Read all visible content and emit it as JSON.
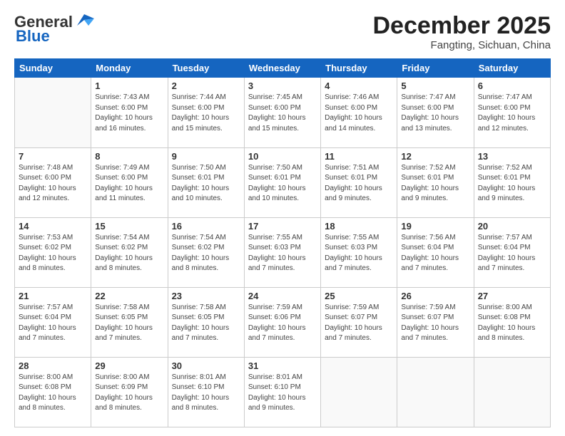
{
  "header": {
    "logo_general": "General",
    "logo_blue": "Blue",
    "title": "December 2025",
    "subtitle": "Fangting, Sichuan, China"
  },
  "calendar": {
    "days_of_week": [
      "Sunday",
      "Monday",
      "Tuesday",
      "Wednesday",
      "Thursday",
      "Friday",
      "Saturday"
    ],
    "weeks": [
      [
        {
          "day": "",
          "info": ""
        },
        {
          "day": "1",
          "info": "Sunrise: 7:43 AM\nSunset: 6:00 PM\nDaylight: 10 hours\nand 16 minutes."
        },
        {
          "day": "2",
          "info": "Sunrise: 7:44 AM\nSunset: 6:00 PM\nDaylight: 10 hours\nand 15 minutes."
        },
        {
          "day": "3",
          "info": "Sunrise: 7:45 AM\nSunset: 6:00 PM\nDaylight: 10 hours\nand 15 minutes."
        },
        {
          "day": "4",
          "info": "Sunrise: 7:46 AM\nSunset: 6:00 PM\nDaylight: 10 hours\nand 14 minutes."
        },
        {
          "day": "5",
          "info": "Sunrise: 7:47 AM\nSunset: 6:00 PM\nDaylight: 10 hours\nand 13 minutes."
        },
        {
          "day": "6",
          "info": "Sunrise: 7:47 AM\nSunset: 6:00 PM\nDaylight: 10 hours\nand 12 minutes."
        }
      ],
      [
        {
          "day": "7",
          "info": "Sunrise: 7:48 AM\nSunset: 6:00 PM\nDaylight: 10 hours\nand 12 minutes."
        },
        {
          "day": "8",
          "info": "Sunrise: 7:49 AM\nSunset: 6:00 PM\nDaylight: 10 hours\nand 11 minutes."
        },
        {
          "day": "9",
          "info": "Sunrise: 7:50 AM\nSunset: 6:01 PM\nDaylight: 10 hours\nand 10 minutes."
        },
        {
          "day": "10",
          "info": "Sunrise: 7:50 AM\nSunset: 6:01 PM\nDaylight: 10 hours\nand 10 minutes."
        },
        {
          "day": "11",
          "info": "Sunrise: 7:51 AM\nSunset: 6:01 PM\nDaylight: 10 hours\nand 9 minutes."
        },
        {
          "day": "12",
          "info": "Sunrise: 7:52 AM\nSunset: 6:01 PM\nDaylight: 10 hours\nand 9 minutes."
        },
        {
          "day": "13",
          "info": "Sunrise: 7:52 AM\nSunset: 6:01 PM\nDaylight: 10 hours\nand 9 minutes."
        }
      ],
      [
        {
          "day": "14",
          "info": "Sunrise: 7:53 AM\nSunset: 6:02 PM\nDaylight: 10 hours\nand 8 minutes."
        },
        {
          "day": "15",
          "info": "Sunrise: 7:54 AM\nSunset: 6:02 PM\nDaylight: 10 hours\nand 8 minutes."
        },
        {
          "day": "16",
          "info": "Sunrise: 7:54 AM\nSunset: 6:02 PM\nDaylight: 10 hours\nand 8 minutes."
        },
        {
          "day": "17",
          "info": "Sunrise: 7:55 AM\nSunset: 6:03 PM\nDaylight: 10 hours\nand 7 minutes."
        },
        {
          "day": "18",
          "info": "Sunrise: 7:55 AM\nSunset: 6:03 PM\nDaylight: 10 hours\nand 7 minutes."
        },
        {
          "day": "19",
          "info": "Sunrise: 7:56 AM\nSunset: 6:04 PM\nDaylight: 10 hours\nand 7 minutes."
        },
        {
          "day": "20",
          "info": "Sunrise: 7:57 AM\nSunset: 6:04 PM\nDaylight: 10 hours\nand 7 minutes."
        }
      ],
      [
        {
          "day": "21",
          "info": "Sunrise: 7:57 AM\nSunset: 6:04 PM\nDaylight: 10 hours\nand 7 minutes."
        },
        {
          "day": "22",
          "info": "Sunrise: 7:58 AM\nSunset: 6:05 PM\nDaylight: 10 hours\nand 7 minutes."
        },
        {
          "day": "23",
          "info": "Sunrise: 7:58 AM\nSunset: 6:05 PM\nDaylight: 10 hours\nand 7 minutes."
        },
        {
          "day": "24",
          "info": "Sunrise: 7:59 AM\nSunset: 6:06 PM\nDaylight: 10 hours\nand 7 minutes."
        },
        {
          "day": "25",
          "info": "Sunrise: 7:59 AM\nSunset: 6:07 PM\nDaylight: 10 hours\nand 7 minutes."
        },
        {
          "day": "26",
          "info": "Sunrise: 7:59 AM\nSunset: 6:07 PM\nDaylight: 10 hours\nand 7 minutes."
        },
        {
          "day": "27",
          "info": "Sunrise: 8:00 AM\nSunset: 6:08 PM\nDaylight: 10 hours\nand 8 minutes."
        }
      ],
      [
        {
          "day": "28",
          "info": "Sunrise: 8:00 AM\nSunset: 6:08 PM\nDaylight: 10 hours\nand 8 minutes."
        },
        {
          "day": "29",
          "info": "Sunrise: 8:00 AM\nSunset: 6:09 PM\nDaylight: 10 hours\nand 8 minutes."
        },
        {
          "day": "30",
          "info": "Sunrise: 8:01 AM\nSunset: 6:10 PM\nDaylight: 10 hours\nand 8 minutes."
        },
        {
          "day": "31",
          "info": "Sunrise: 8:01 AM\nSunset: 6:10 PM\nDaylight: 10 hours\nand 9 minutes."
        },
        {
          "day": "",
          "info": ""
        },
        {
          "day": "",
          "info": ""
        },
        {
          "day": "",
          "info": ""
        }
      ]
    ]
  }
}
